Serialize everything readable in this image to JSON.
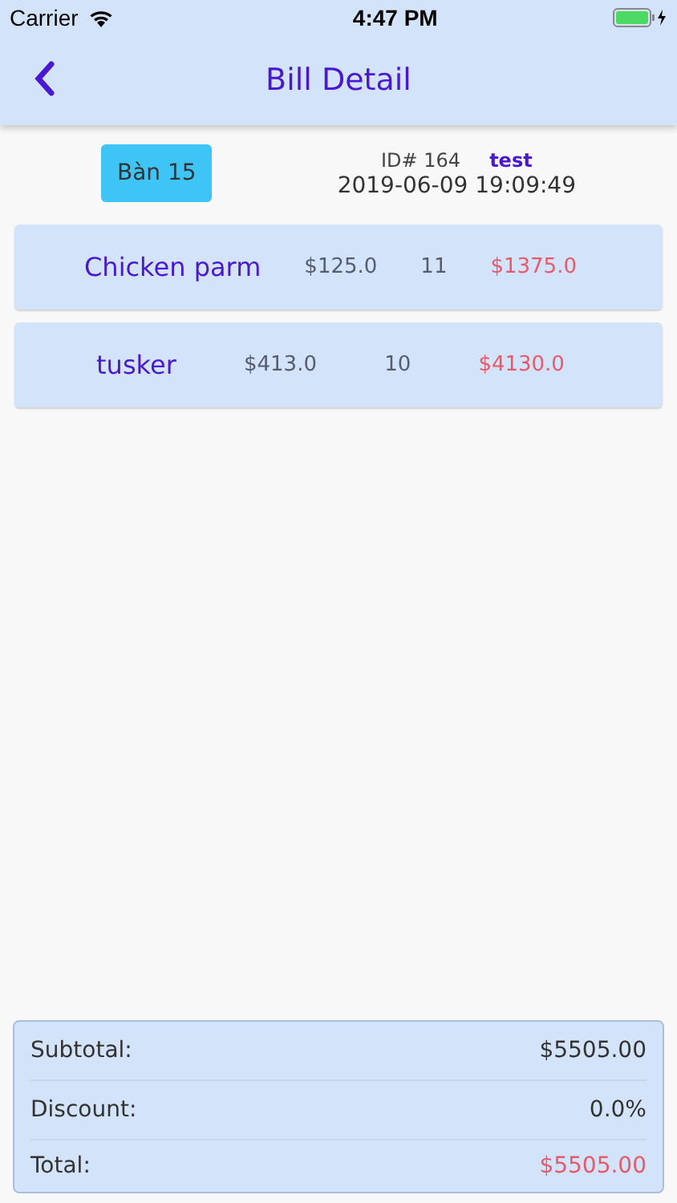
{
  "status_bar": {
    "carrier": "Carrier",
    "time": "4:47 PM"
  },
  "nav_bar": {
    "title": "Bill Detail"
  },
  "bill": {
    "table": "Bàn 15",
    "id": "ID# 164",
    "user": "test",
    "datetime": "2019-06-09 19:09:49"
  },
  "items": [
    {
      "name": "Chicken parm",
      "price": "$125.0",
      "quantity": "11",
      "total": "$1375.0"
    },
    {
      "name": "tusker",
      "price": "$413.0",
      "quantity": "10",
      "total": "$4130.0"
    }
  ],
  "summary": [
    {
      "kind": "plain",
      "label": "Subtotal:",
      "value": "$5505.00"
    },
    {
      "kind": "plain",
      "label": "Discount:",
      "value": "0.0%"
    },
    {
      "kind": "total",
      "label": "Total:",
      "value": "$5505.00"
    }
  ]
}
